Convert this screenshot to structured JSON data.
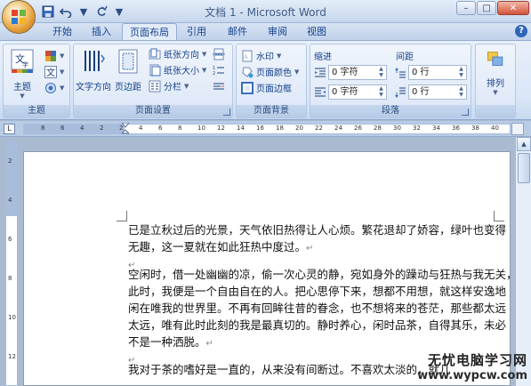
{
  "window": {
    "title": "文档 1 - Microsoft Word"
  },
  "tabs": [
    "开始",
    "插入",
    "页面布局",
    "引用",
    "邮件",
    "审阅",
    "视图"
  ],
  "active_tab": "页面布局",
  "ribbon": {
    "themes": {
      "big": "主题",
      "label": "主题"
    },
    "page_setup": {
      "text_direction": "文字方向",
      "margins": "页边距",
      "orientation": "纸张方向",
      "size": "纸张大小",
      "columns": "分栏",
      "label": "页面设置"
    },
    "page_background": {
      "watermark": "水印",
      "page_color": "页面颜色",
      "page_borders": "页面边框",
      "label": "页面背景"
    },
    "paragraph": {
      "indent_label": "缩进",
      "spacing_label": "间距",
      "indent_left": "0 字符",
      "indent_right": "0 字符",
      "space_before": "0 行",
      "space_after": "0 行",
      "label": "段落"
    },
    "arrange": {
      "big": "排列"
    }
  },
  "ruler": {
    "tab_marker": "L",
    "ticks": [
      "8",
      "6",
      "4",
      "2",
      "2",
      "4",
      "6",
      "8",
      "10",
      "12",
      "14",
      "16",
      "18",
      "20",
      "22",
      "24",
      "26",
      "28",
      "30",
      "32",
      "34",
      "36",
      "38",
      "40"
    ]
  },
  "vruler": {
    "ticks": [
      "2",
      "4",
      "6",
      "8",
      "10",
      "12"
    ]
  },
  "document": {
    "paragraphs": [
      [
        "已是立秋过后的光景，天气依旧热得让人心烦。繁花退却了娇容，绿叶也变得",
        "无趣，这一夏就在如此狂热中度过。"
      ],
      [
        ""
      ],
      [
        "空闲时，借一处幽幽的凉，偷一次心灵的静，宛如身外的躁动与狂热与我无关，",
        "此时，我便是一个自由自在的人。把心思停下来，想都不用想，就这样安逸地",
        "闲在唯我的世界里。不再有回眸往昔的眷念，也不想将来的苍茫，那些都太远",
        "太远，唯有此时此刻的我是最真切的。静时养心，闲时品茶，自得其乐，未必",
        "不是一种洒脱。"
      ],
      [
        ""
      ],
      [
        "我对于茶的嗜好是一直的，从来没有间断过。不喜欢太淡的，就几"
      ]
    ]
  },
  "watermark_text": {
    "line1": "无忧电脑学习网",
    "line2": "www.wypcw.com"
  }
}
